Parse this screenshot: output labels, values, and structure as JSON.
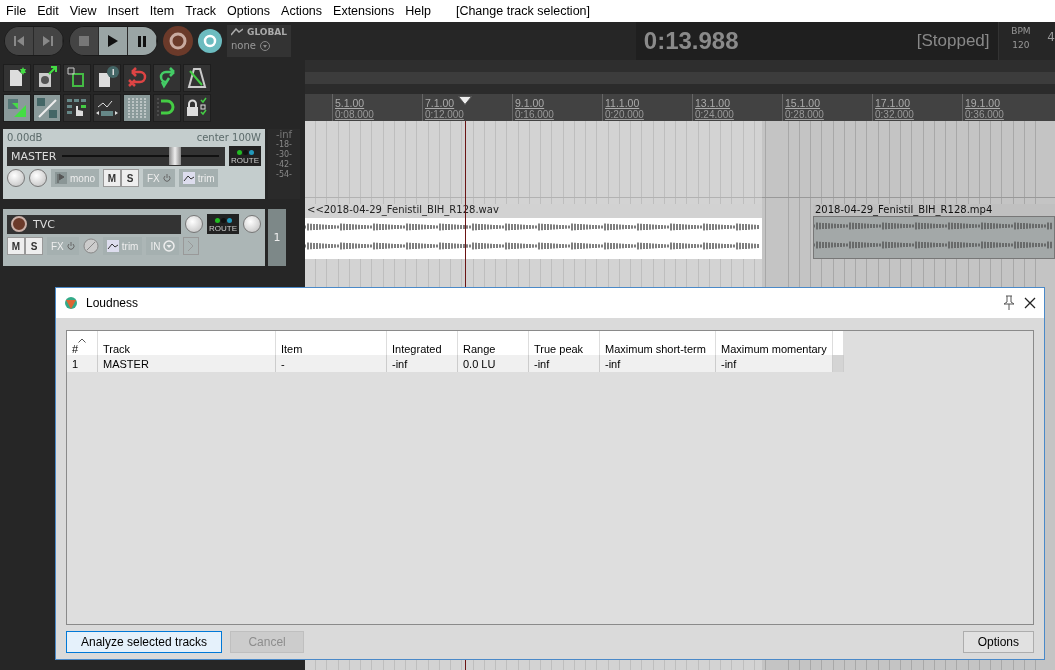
{
  "menu": {
    "items": [
      "File",
      "Edit",
      "View",
      "Insert",
      "Item",
      "Track",
      "Options",
      "Actions",
      "Extensions",
      "Help"
    ],
    "status": "[Change track selection]"
  },
  "transport": {
    "automation": {
      "label": "GLOBAL",
      "value": "none"
    },
    "time": "0:13.988",
    "state": "[Stopped]",
    "bpm_label": "BPM",
    "bpm": "120",
    "column_3": "4"
  },
  "toolbar": [
    [
      {
        "on": false
      },
      {
        "on": false
      },
      {
        "on": false
      },
      {
        "on": false
      },
      {
        "on": false
      },
      {
        "on": false
      },
      {
        "on": false
      }
    ],
    [
      {
        "on": true
      },
      {
        "on": true
      },
      {
        "on": false
      },
      {
        "on": false
      },
      {
        "on": true
      },
      {
        "on": false
      },
      {
        "on": false
      }
    ]
  ],
  "ruler": [
    {
      "bar": "5.1.00",
      "time": "0:08.000"
    },
    {
      "bar": "7.1.00",
      "time": "0:12.000"
    },
    {
      "bar": "9.1.00",
      "time": "0:16.000"
    },
    {
      "bar": "11.1.00",
      "time": "0:20.000"
    },
    {
      "bar": "13.1.00",
      "time": "0:24.000"
    },
    {
      "bar": "15.1.00",
      "time": "0:28.000"
    },
    {
      "bar": "17.1.00",
      "time": "0:32.000"
    },
    {
      "bar": "19.1.00",
      "time": "0:36.000"
    }
  ],
  "master": {
    "volume": "0.00dB",
    "pan": "center",
    "width": "100W",
    "name": "MASTER",
    "level": 0.72,
    "route": "ROUTE",
    "mono": "mono",
    "mute": "M",
    "solo": "S",
    "fx": "FX",
    "trim": "trim",
    "meter": "-inf",
    "scale": [
      "-18-",
      "-30-",
      "-42-",
      "-54-"
    ]
  },
  "tracks": [
    {
      "name": "TVC",
      "route": "ROUTE",
      "mute": "M",
      "solo": "S",
      "fx": "FX",
      "trim": "trim",
      "input": "IN",
      "number": "1"
    }
  ],
  "items": [
    {
      "name": "<<2018-04-29_Fenistil_BIH_R128.wav",
      "selected": false
    },
    {
      "name": "2018-04-29_Fenistil_BIH_R128.mp4",
      "selected": true
    }
  ],
  "dialog": {
    "title": "Loudness",
    "columns": [
      "#",
      "Track",
      "Item",
      "Integrated",
      "Range",
      "True peak",
      "Maximum short-term",
      "Maximum momentary"
    ],
    "rows": [
      [
        "1",
        "MASTER",
        "-",
        "-inf",
        "0.0 LU",
        "-inf",
        "-inf",
        "-inf"
      ]
    ],
    "buttons": [
      {
        "label": "Analyze selected tracks",
        "kind": "default",
        "disabled": false
      },
      {
        "label": "Cancel",
        "kind": "normal",
        "disabled": true
      },
      {
        "label": "Options",
        "kind": "normal",
        "disabled": false
      }
    ]
  }
}
